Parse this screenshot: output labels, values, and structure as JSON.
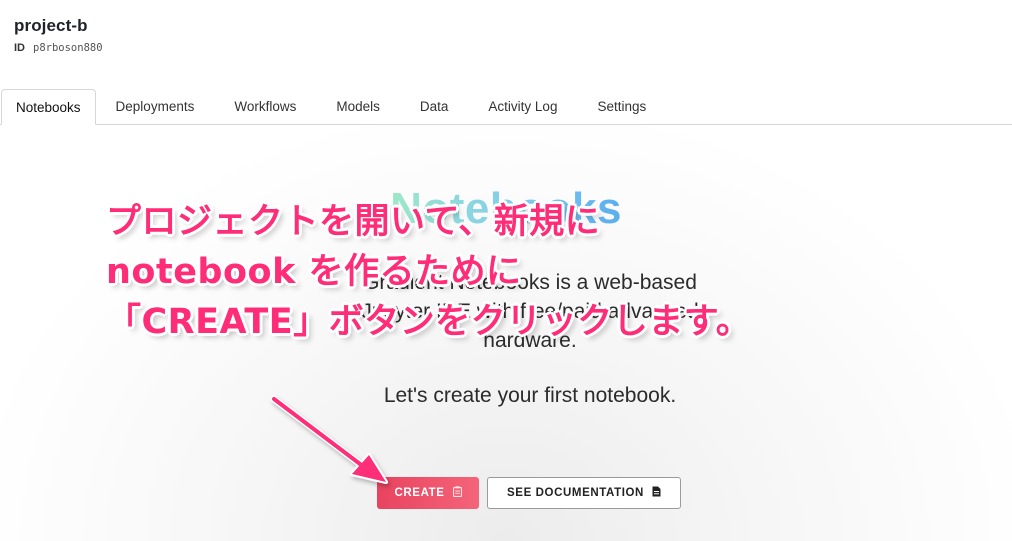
{
  "project": {
    "name": "project-b",
    "id_label": "ID",
    "id_value": "p8rboson880"
  },
  "tabs": [
    {
      "label": "Notebooks",
      "active": true
    },
    {
      "label": "Deployments",
      "active": false
    },
    {
      "label": "Workflows",
      "active": false
    },
    {
      "label": "Models",
      "active": false
    },
    {
      "label": "Data",
      "active": false
    },
    {
      "label": "Activity Log",
      "active": false
    },
    {
      "label": "Settings",
      "active": false
    }
  ],
  "empty_state": {
    "title": "Notebooks",
    "description": "Gradient Notebooks is a web-based Jupyter IDE with free/paid advanced hardware.",
    "cta": "Let's create your first notebook."
  },
  "buttons": {
    "create_label": "CREATE",
    "create_icon": "notebook-icon",
    "docs_label": "SEE DOCUMENTATION",
    "docs_icon": "document-icon"
  },
  "annotation": {
    "lines": [
      "プロジェクトを開いて、新規に",
      "notebook を作るために",
      "「CREATE」ボタンをクリックします。"
    ],
    "color": "#ff2d78"
  },
  "colors": {
    "accent": "#e8435f",
    "title_gradient_start": "#9ee8c8",
    "title_gradient_end": "#5aaeee"
  }
}
